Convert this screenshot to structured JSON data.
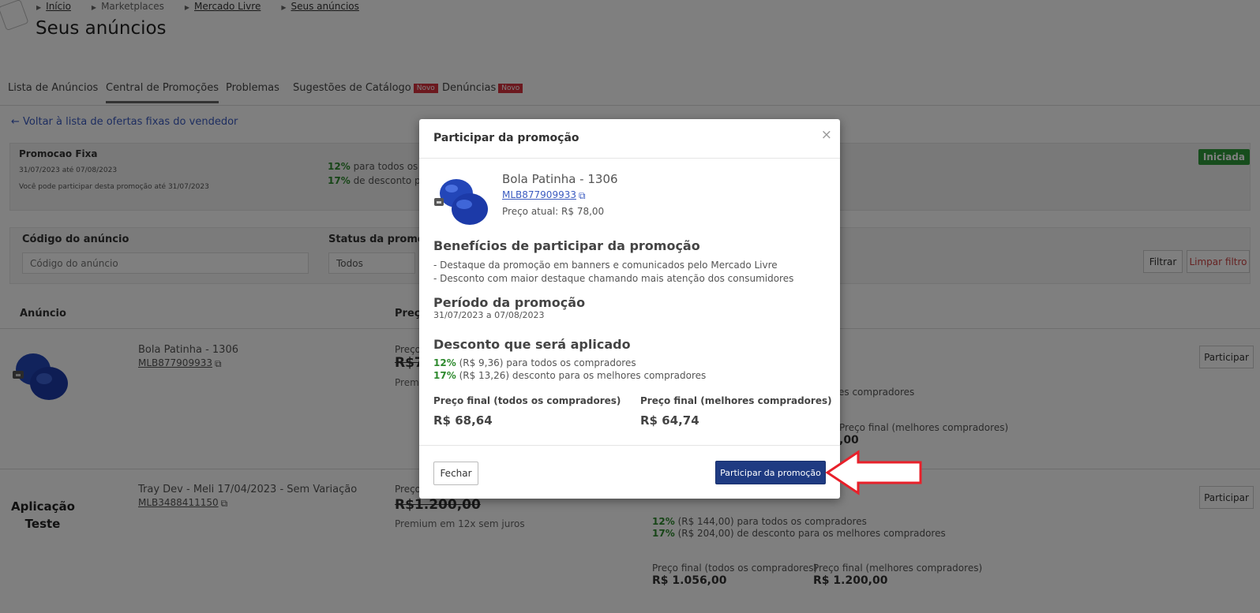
{
  "breadcrumb": [
    {
      "label": "Início",
      "link": true
    },
    {
      "label": "Marketplaces",
      "link": false
    },
    {
      "label": "Mercado Livre",
      "link": true
    },
    {
      "label": "Seus anúncios",
      "link": true
    }
  ],
  "page_title": "Seus anúncios",
  "tabs": [
    {
      "label": "Lista de Anúncios"
    },
    {
      "label": "Central de Promoções"
    },
    {
      "label": "Problemas"
    },
    {
      "label": "Sugestões de Catálogo",
      "badge": "Novo"
    },
    {
      "label": "Denúncias",
      "badge": "Novo"
    }
  ],
  "back_link": "Voltar à lista de ofertas fixas do vendedor",
  "promo": {
    "name": "Promocao Fixa",
    "dates": "31/07/2023 até 07/08/2023",
    "until": "Você pode participar desta promoção até 31/07/2023",
    "line1_pct": "12%",
    "line1_text": "para todos os c",
    "line2_pct": "17%",
    "line2_text": "de desconto par",
    "status": "Iniciada"
  },
  "filters": {
    "code_label": "Código do anúncio",
    "code_placeholder": "Código do anúncio",
    "status_label": "Status da promoç",
    "status_value": "Todos",
    "filter_button": "Filtrar",
    "clear_button": "Limpar filtro"
  },
  "table": {
    "col_anuncio": "Anúncio",
    "col_preco": "Preço",
    "rows": [
      {
        "title": "Bola Patinha - 1306",
        "code": "MLB877909933",
        "price_label": "Preço",
        "price": "R$7",
        "price_sub": "Prem",
        "line1": "es compradores",
        "final_label": "Preço final (melhores compradores)",
        "final_value": ",00",
        "button": "Participar"
      },
      {
        "app_label": "Aplicação Teste",
        "title": "Tray Dev - Meli 17/04/2023 - Sem Variação",
        "code": "MLB3488411150",
        "price_label": "Preço",
        "price": "R$1.200,00",
        "price_sub": "Premium em 12x sem juros",
        "line1_pct": "12%",
        "line1_text": "(R$ 144,00) para todos os compradores",
        "line2_pct": "17%",
        "line2_text": "(R$ 204,00) de desconto para os melhores compradores",
        "final_all_label": "Preço final (todos os compradores)",
        "final_all_value": "R$ 1.056,00",
        "final_best_label": "Preço final (melhores compradores)",
        "final_best_value": "R$ 1.200,00",
        "button": "Participar"
      }
    ]
  },
  "modal": {
    "title": "Participar da promoção",
    "close": "×",
    "product_name": "Bola Patinha - 1306",
    "product_code": "MLB877909933",
    "product_price": "Preço atual: R$ 78,00",
    "benefits_title": "Benefícios de participar da promoção",
    "benefits": [
      "- Destaque da promoção em banners e comunicados pelo Mercado Livre",
      "- Desconto com maior destaque chamando mais atenção dos consumidores"
    ],
    "period_title": "Período da promoção",
    "period": "31/07/2023 a 07/08/2023",
    "discount_title": "Desconto que será aplicado",
    "discount1_pct": "12%",
    "discount1_text": "(R$ 9,36) para todos os compradores",
    "discount2_pct": "17%",
    "discount2_text": "(R$ 13,26) desconto para os melhores compradores",
    "final_all_label": "Preço final (todos os compradores)",
    "final_all_value": "R$ 68,64",
    "final_best_label": "Preço final (melhores compradores)",
    "final_best_value": "R$ 64,74",
    "close_button": "Fechar",
    "confirm_button": "Participar da promoção"
  },
  "colors": {
    "primary_button": "#1f3b82",
    "discount_green": "#2e8a2e",
    "status_green": "#2e9a3a",
    "badge_red": "#d9333f",
    "annotation_arrow": "#e8202a"
  }
}
